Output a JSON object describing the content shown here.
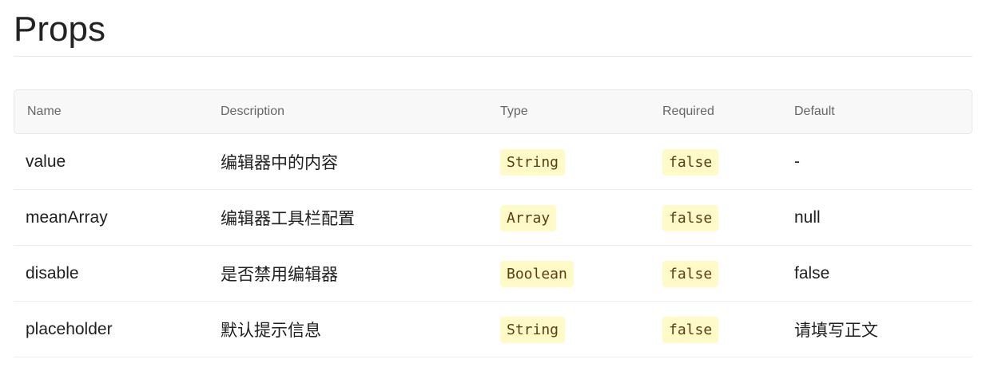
{
  "title": "Props",
  "headers": [
    "Name",
    "Description",
    "Type",
    "Required",
    "Default"
  ],
  "rows": [
    {
      "name": "value",
      "description": "编辑器中的内容",
      "type": "String",
      "required": "false",
      "default": "-"
    },
    {
      "name": "meanArray",
      "description": "编辑器工具栏配置",
      "type": "Array",
      "required": "false",
      "default": "null"
    },
    {
      "name": "disable",
      "description": "是否禁用编辑器",
      "type": "Boolean",
      "required": "false",
      "default": "false"
    },
    {
      "name": "placeholder",
      "description": "默认提示信息",
      "type": "String",
      "required": "false",
      "default": "请填写正文"
    }
  ]
}
